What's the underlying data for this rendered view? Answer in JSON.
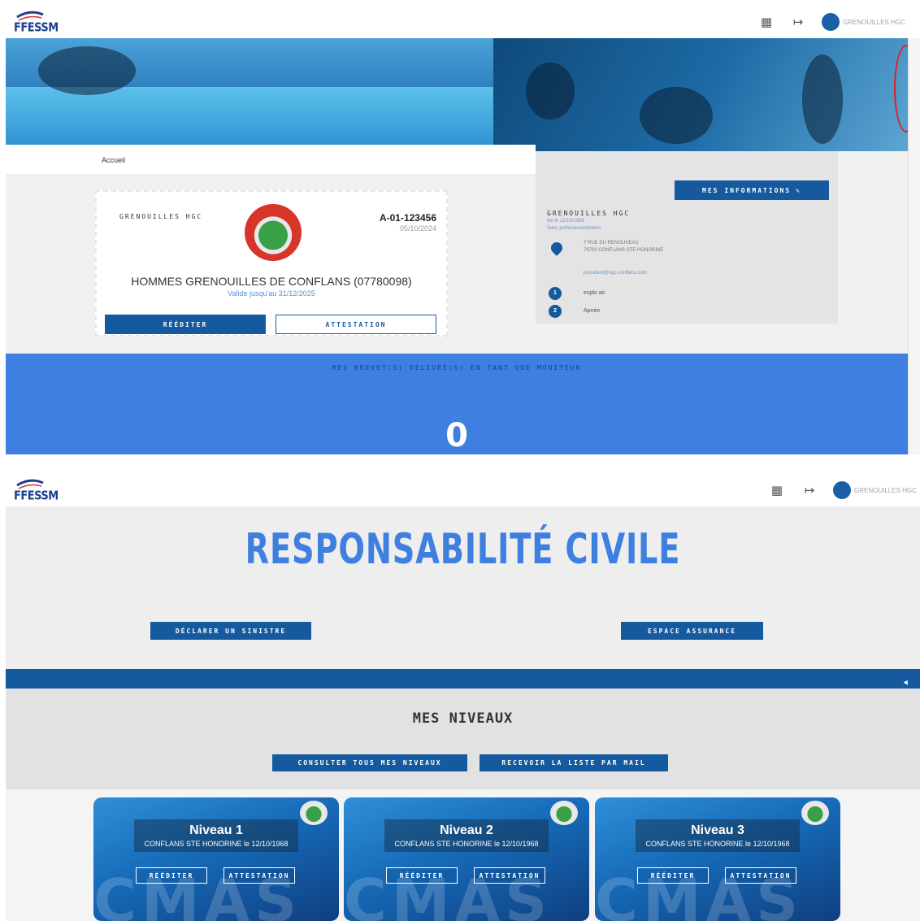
{
  "header": {
    "logo_text": "FFESSM",
    "user_name": "GRENOUILLES HGC",
    "apps_icon": "grid-icon",
    "logout_icon": "logout-icon",
    "avatar_icon": "club-avatar-icon"
  },
  "breadcrumb": {
    "label": "Accueil"
  },
  "license_card": {
    "club_short": "GRENOUILLES HGC",
    "license_number": "A-01-123456",
    "license_date": "05/10/2024",
    "club_full": "HOMMES GRENOUILLES DE CONFLANS (07780098)",
    "valid_until": "Valide jusqu'au 31/12/2025",
    "reissue_label": "RÉÉDITER",
    "certificate_label": "ATTESTATION"
  },
  "info_panel": {
    "button_label": "MES INFORMATIONS",
    "club_name": "GRENOUILLES HGC",
    "birth": "Né le 12/10/1968",
    "occupation": "Sans profession/retraités",
    "address_line1": "7 RUE DU RENOUVEAU",
    "address_line2": "78700 CONFLANS STE HONORINE",
    "email": "president@hgc-conflans.com",
    "items": [
      {
        "number": "1",
        "label": "explo air"
      },
      {
        "number": "2",
        "label": "Apnée"
      }
    ]
  },
  "instructor": {
    "title": "MES BREVET(S) DÉLIVRÉ(S) EN TANT QUE MONITEUR",
    "count": "0"
  },
  "civil_liability": {
    "title": "RESPONSABILITÉ CIVILE",
    "declare_label": "DÉCLARER UN SINISTRE",
    "insurance_label": "ESPACE ASSURANCE"
  },
  "levels": {
    "title": "MES NIVEAUX",
    "view_all_label": "CONSULTER TOUS MES NIVEAUX",
    "email_list_label": "RECEVOIR LA LISTE PAR MAIL",
    "cards": [
      {
        "title": "Niveau 1",
        "place": "CONFLANS STE HONORINE le 12/10/1968",
        "reissue": "RÉÉDITER",
        "certificate": "ATTESTATION"
      },
      {
        "title": "Niveau 2",
        "place": "CONFLANS STE HONORINE le 12/10/1968",
        "reissue": "RÉÉDITER",
        "certificate": "ATTESTATION"
      },
      {
        "title": "Niveau 3",
        "place": "CONFLANS STE HONORINE le 12/10/1968",
        "reissue": "RÉÉDITER",
        "certificate": "ATTESTATION"
      }
    ]
  },
  "colors": {
    "primary": "#155a9e",
    "accent_blue": "#3f7fe0",
    "highlight_red": "#e02020"
  }
}
